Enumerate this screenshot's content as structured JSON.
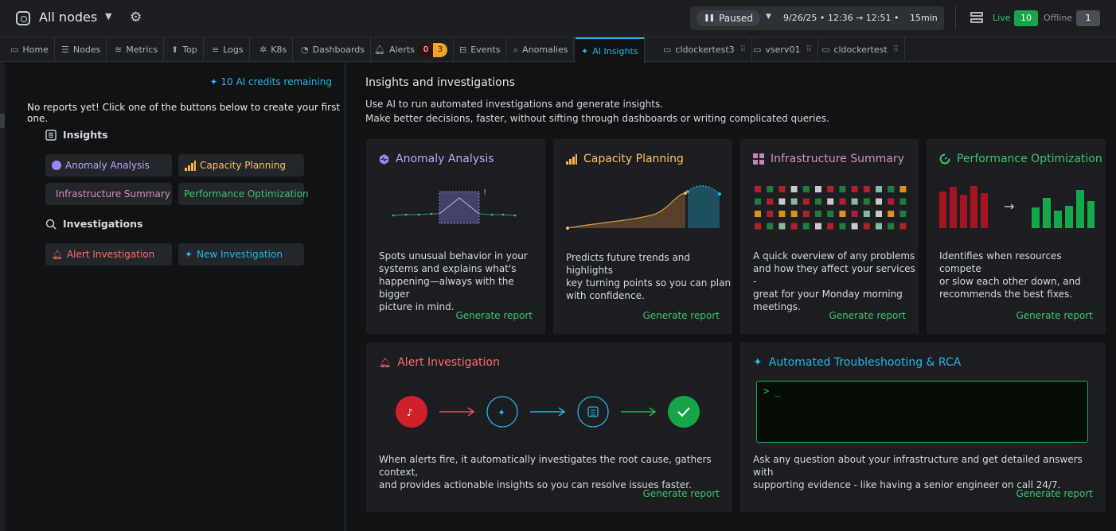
{
  "header": {
    "space_title": "All nodes",
    "paused_label": "Paused",
    "time_range": "9/26/25 • 12:36 → 12:51 •",
    "duration": "15min",
    "live_label": "Live",
    "live_count": "10",
    "offline_label": "Offline",
    "offline_count": "1"
  },
  "tabs": [
    {
      "label": "Home",
      "icon": "monitor-icon"
    },
    {
      "label": "Nodes",
      "icon": "server-icon"
    },
    {
      "label": "Metrics",
      "icon": "charts-icon"
    },
    {
      "label": "Top",
      "icon": "arrow-up-icon"
    },
    {
      "label": "Logs",
      "icon": "logs-icon"
    },
    {
      "label": "K8s",
      "icon": "kubernetes-icon"
    },
    {
      "label": "Dashboards",
      "icon": "dashboard-gauge-icon"
    },
    {
      "label": "Alerts",
      "icon": "bell-icon",
      "badge_critical": "0",
      "badge_warning": "3"
    },
    {
      "label": "Events",
      "icon": "events-icon"
    },
    {
      "label": "Anomalies",
      "icon": "magnifier-icon"
    },
    {
      "label": "AI Insights",
      "icon": "sparkle-icon",
      "active": true
    },
    {
      "label": "cldockertest3",
      "icon": "node-icon"
    },
    {
      "label": "vserv01",
      "icon": "node-icon"
    },
    {
      "label": "cldockertest",
      "icon": "node-icon"
    }
  ],
  "sidebar": {
    "credits": "10 AI credits remaining",
    "empty_message": "No reports yet! Click one of the buttons below to create your first one.",
    "insights_heading": "Insights",
    "investigations_heading": "Investigations",
    "insight_buttons": [
      "Anomaly Analysis",
      "Capacity Planning",
      "Infrastructure Summary",
      "Performance Optimization"
    ],
    "investigation_buttons": [
      "Alert Investigation",
      "New Investigation"
    ]
  },
  "main": {
    "title": "Insights and investigations",
    "subtitle_1": "Use AI to run automated investigations and generate insights.",
    "subtitle_2": "Make better decisions, faster, without sifting through dashboards or writing complicated queries.",
    "cards": [
      {
        "title": "Anomaly Analysis",
        "desc": [
          "Spots unusual behavior in your",
          "systems and explains what's",
          "happening—always with the bigger",
          "picture in mind."
        ],
        "action": "Generate report",
        "color": "#b9a8ff"
      },
      {
        "title": "Capacity Planning",
        "desc": [
          "Predicts future trends and highlights",
          "key turning points so you can plan",
          "with confidence."
        ],
        "action": "Generate report",
        "color": "#ffc266"
      },
      {
        "title": "Infrastructure Summary",
        "desc": [
          "A quick overview of any problems",
          "and how they affect your services -",
          "great for your Monday morning",
          "meetings."
        ],
        "action": "Generate report",
        "color": "#d08fbf"
      },
      {
        "title": "Performance Optimization",
        "desc": [
          "Identifies when resources compete",
          "or slow each other down, and",
          "recommends the best fixes."
        ],
        "action": "Generate report",
        "color": "#3ec26b"
      },
      {
        "title": "Alert Investigation",
        "desc": [
          "When alerts fire, it automatically investigates the root cause, gathers context,",
          "and provides actionable insights so you can resolve issues faster."
        ],
        "action": "Generate report",
        "color": "#ff6b6b"
      },
      {
        "title": "Automated Troubleshooting & RCA",
        "desc": [
          "Ask any question about your infrastructure and get detailed answers with",
          "supporting evidence - like having a senior engineer on call 24/7."
        ],
        "action": "Generate report",
        "color": "#27b4e6",
        "terminal_text": "> _"
      }
    ]
  }
}
